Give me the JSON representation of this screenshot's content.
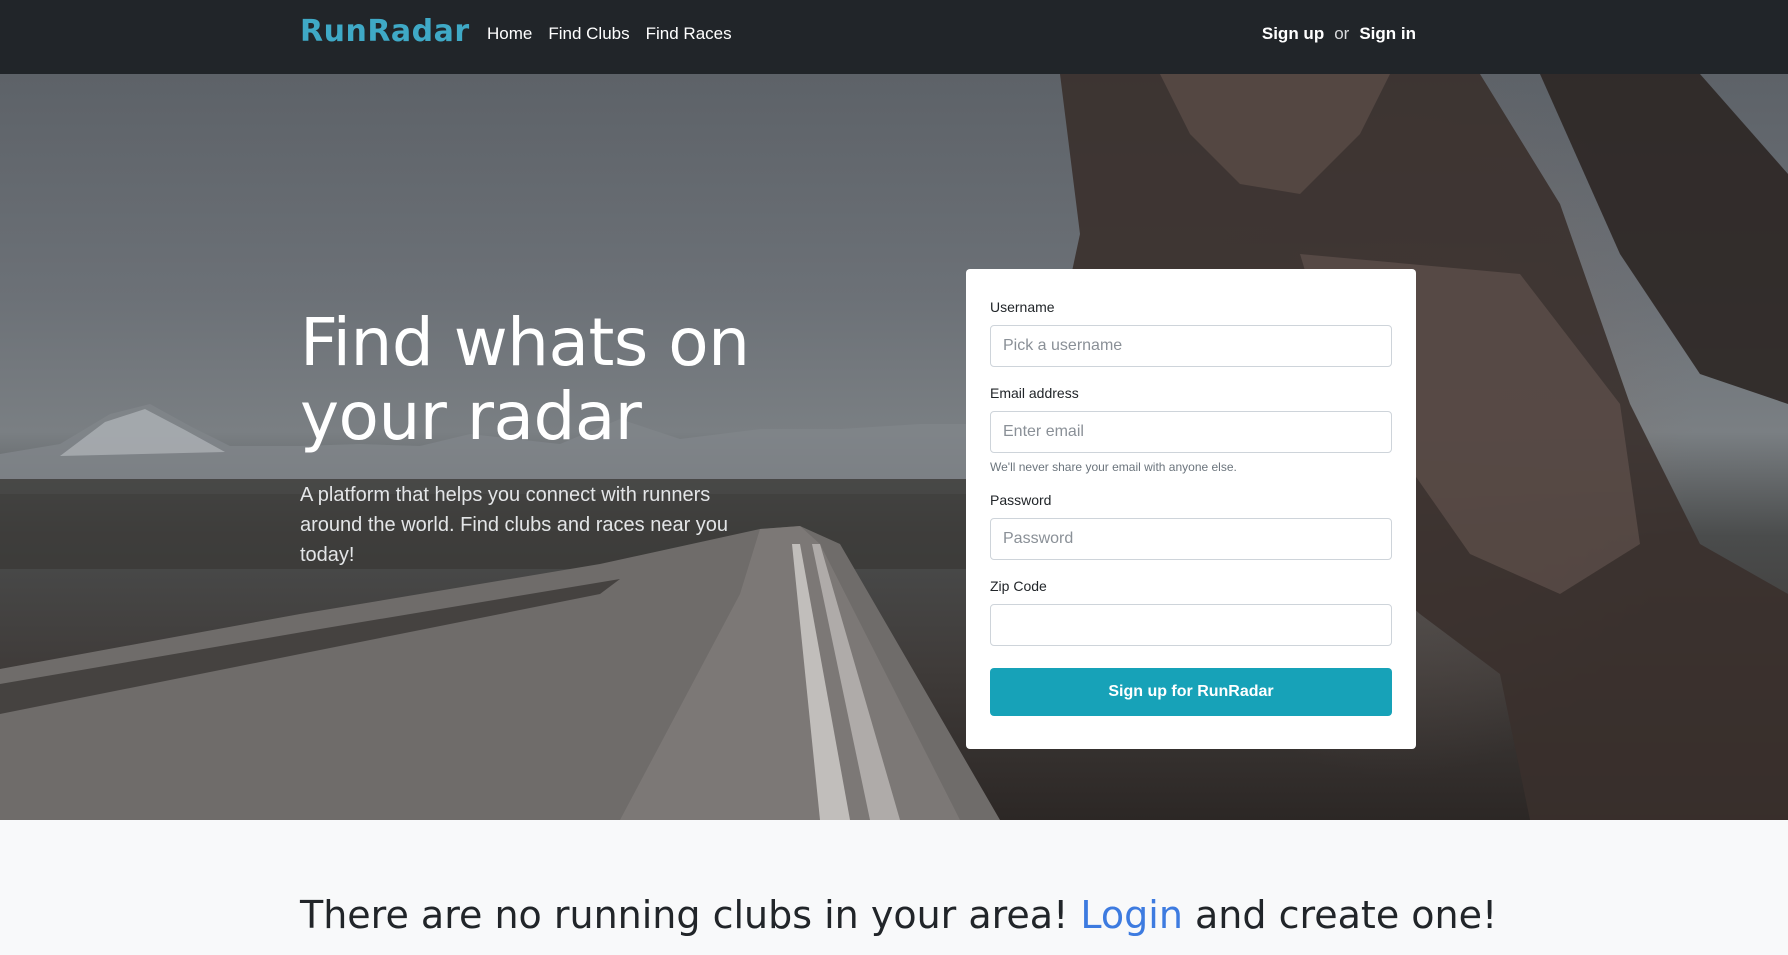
{
  "navbar": {
    "brand": "RunRadar",
    "links": [
      {
        "label": "Home"
      },
      {
        "label": "Find Clubs"
      },
      {
        "label": "Find Races"
      }
    ],
    "signup_label": "Sign up",
    "or_label": "or",
    "signin_label": "Sign in"
  },
  "hero": {
    "title_line1": "Find whats on",
    "title_line2": "your radar",
    "subtitle": "A platform that helps you connect with runners around the world. Find clubs and races near you today!"
  },
  "signup_form": {
    "username": {
      "label": "Username",
      "placeholder": "Pick a username",
      "value": ""
    },
    "email": {
      "label": "Email address",
      "placeholder": "Enter email",
      "value": "",
      "help": "We'll never share your email with anyone else."
    },
    "password": {
      "label": "Password",
      "placeholder": "Password",
      "value": ""
    },
    "zip": {
      "label": "Zip Code",
      "placeholder": "",
      "value": ""
    },
    "submit_label": "Sign up for RunRadar"
  },
  "empty_state": {
    "text_before": "There are no running clubs in your area! ",
    "link_label": "Login",
    "text_after": " and create one!"
  },
  "colors": {
    "navbar_bg": "#212529",
    "brand": "#3fa9c6",
    "button": "#17a2b8",
    "link": "#3d7be0"
  }
}
